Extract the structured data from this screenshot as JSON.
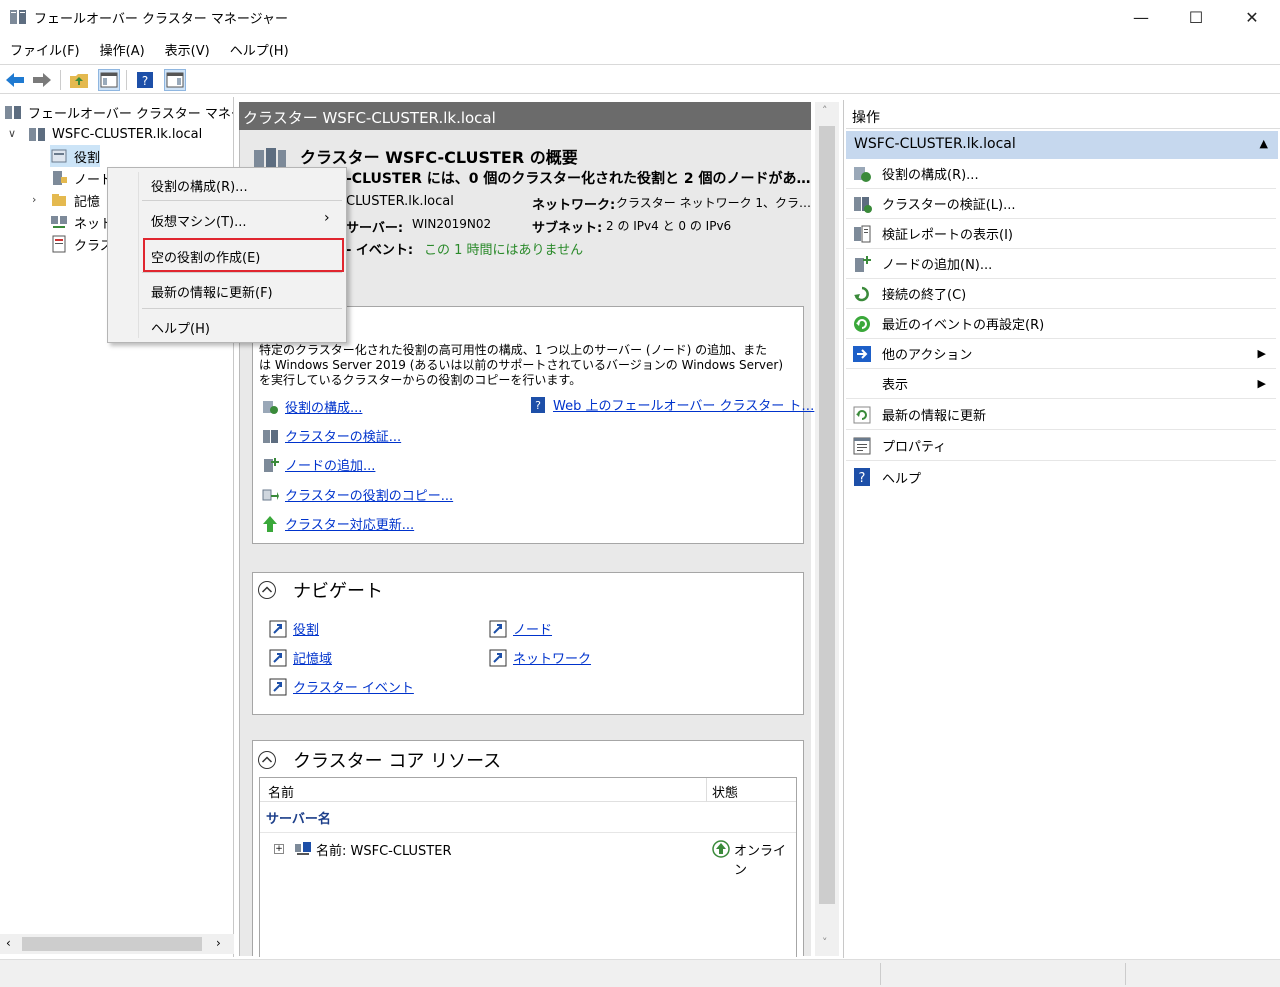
{
  "window": {
    "title": "フェールオーバー クラスター マネージャー",
    "minimize": "—",
    "maximize": "☐",
    "close": "✕"
  },
  "menubar": [
    "ファイル(F)",
    "操作(A)",
    "表示(V)",
    "ヘルプ(H)"
  ],
  "tree": {
    "root": "フェールオーバー クラスター マネージャ",
    "cluster": "WSFC-CLUSTER.lk.local",
    "items": [
      "役割",
      "ノード",
      "記憶",
      "ネット",
      "クラス"
    ]
  },
  "context_menu": {
    "items": [
      "役割の構成(R)...",
      "仮想マシン(T)...",
      "空の役割の作成(E)",
      "最新の情報に更新(F)",
      "ヘルプ(H)"
    ],
    "submenu_arrow": "›"
  },
  "middle": {
    "header": "クラスター WSFC-CLUSTER.lk.local",
    "summary_title": "クラスター WSFC-CLUSTER の概要",
    "summary_line": "-CLUSTER には、0 個のクラスター化された役割と 2 個のノードがあ…",
    "domain_value": "CLUSTER.lk.local",
    "network_label": "ネットワーク:",
    "network_value": "クラスター ネットワーク 1、クラ…",
    "server_label": "サーバー:",
    "server_value": "WIN2019N02",
    "subnet_label": "サブネット:",
    "subnet_value": "2 の IPv4 と 0 の IPv6",
    "event_label": "- イベント:",
    "event_value": "この 1 時間にはありません",
    "config": {
      "description": "特定のクラスター化された役割の高可用性の構成、1 つ以上のサーバー (ノード) の追加、または Windows Server 2019 (あるいは以前のサポートされているバージョンの Windows Server) を実行しているクラスターからの役割のコピーを行います。",
      "desc_line1": "特定のクラスター化された役割の高可用性の構成、1 つ以上のサーバー (ノード) の追加、また",
      "desc_line2": "は Windows Server 2019 (あるいは以前のサポートされているバージョンの Windows Server)",
      "desc_line3": "を実行しているクラスターからの役割のコピーを行います。",
      "links": [
        "役割の構成...",
        "クラスターの検証...",
        "ノードの追加...",
        "クラスターの役割のコピー...",
        "クラスター対応更新..."
      ],
      "web_link": "Web 上のフェールオーバー クラスター ト…"
    },
    "navigate": {
      "title": "ナビゲート",
      "links": [
        "役割",
        "ノード",
        "記憶域",
        "ネットワーク",
        "クラスター イベント"
      ]
    },
    "core": {
      "title": "クラスター コア リソース",
      "col_name": "名前",
      "col_status": "状態",
      "group": "サーバー名",
      "row_name": "名前: WSFC-CLUSTER",
      "row_status": "オンライン"
    }
  },
  "actions": {
    "header": "操作",
    "subheader": "WSFC-CLUSTER.lk.local",
    "items": [
      {
        "label": "役割の構成(R)...",
        "icon": "configure-role-icon"
      },
      {
        "label": "クラスターの検証(L)...",
        "icon": "validate-cluster-icon"
      },
      {
        "label": "検証レポートの表示(I)",
        "icon": "report-icon"
      },
      {
        "label": "ノードの追加(N)...",
        "icon": "add-node-icon"
      },
      {
        "label": "接続の終了(C)",
        "icon": "close-connection-icon"
      },
      {
        "label": "最近のイベントの再設定(R)",
        "icon": "reset-events-icon"
      },
      {
        "label": "他のアクション",
        "icon": "more-actions-icon"
      },
      {
        "label": "表示",
        "icon": ""
      },
      {
        "label": "最新の情報に更新",
        "icon": "refresh-icon"
      },
      {
        "label": "プロパティ",
        "icon": "properties-icon"
      },
      {
        "label": "ヘルプ",
        "icon": "help-icon"
      }
    ]
  },
  "colors": {
    "accent_header": "#6b6b6b",
    "action_subheader": "#c6d8ee",
    "link": "#0033cc",
    "highlight": "#e0262f"
  }
}
